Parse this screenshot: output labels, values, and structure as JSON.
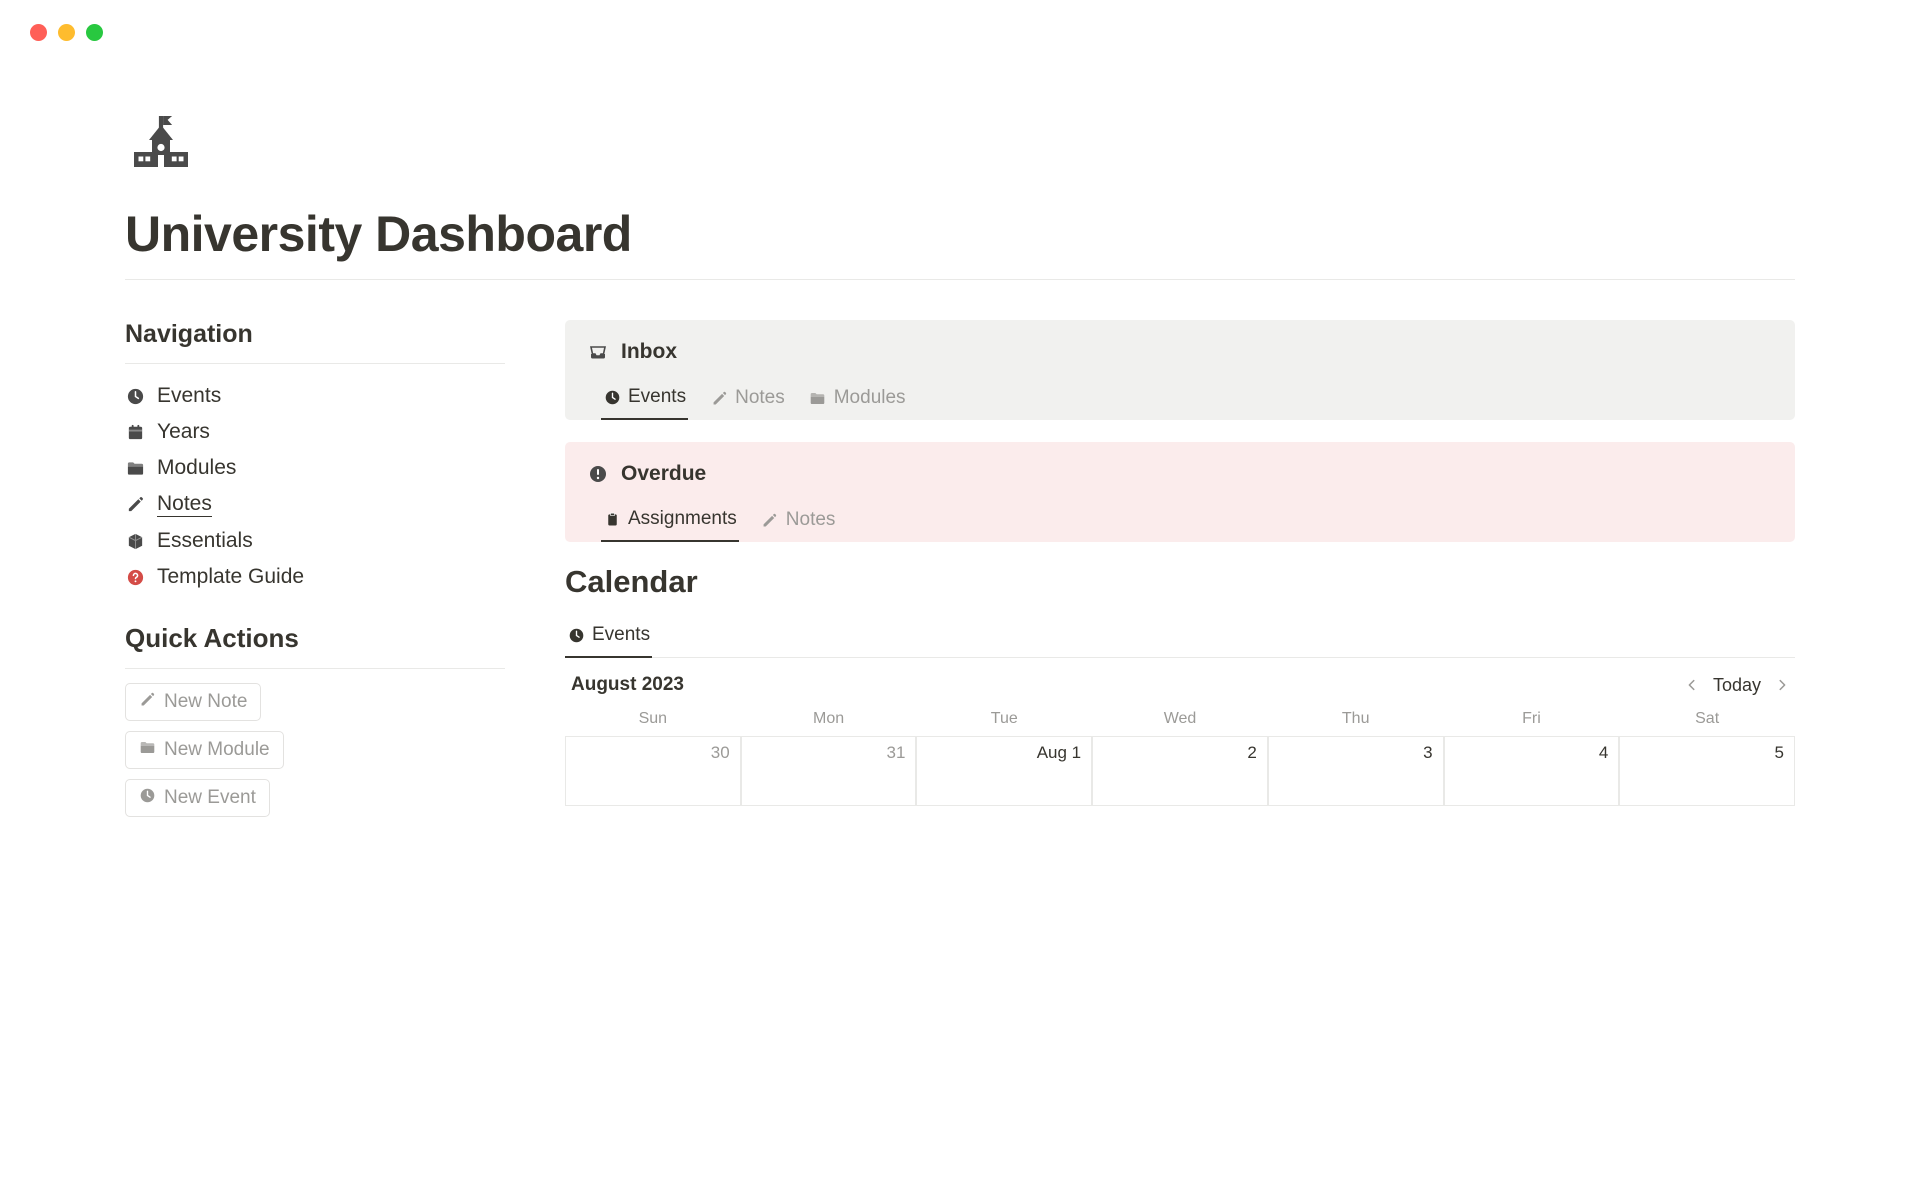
{
  "traffic": {
    "colors": [
      "#ff5f57",
      "#febc2e",
      "#28c840"
    ]
  },
  "page": {
    "title": "University Dashboard"
  },
  "navigation": {
    "heading": "Navigation",
    "items": [
      {
        "icon": "clock",
        "label": "Events"
      },
      {
        "icon": "calendar",
        "label": "Years"
      },
      {
        "icon": "folder",
        "label": "Modules"
      },
      {
        "icon": "pencil",
        "label": "Notes",
        "underline": true
      },
      {
        "icon": "box",
        "label": "Essentials"
      },
      {
        "icon": "help-red",
        "label": "Template Guide"
      }
    ]
  },
  "quickActions": {
    "heading": "Quick Actions",
    "items": [
      {
        "icon": "pencil",
        "label": "New Note"
      },
      {
        "icon": "folder",
        "label": "New Module"
      },
      {
        "icon": "clock",
        "label": "New Event"
      }
    ]
  },
  "inbox": {
    "title": "Inbox",
    "tabs": [
      {
        "icon": "clock",
        "label": "Events",
        "active": true
      },
      {
        "icon": "pencil",
        "label": "Notes",
        "active": false
      },
      {
        "icon": "folder",
        "label": "Modules",
        "active": false
      }
    ]
  },
  "overdue": {
    "title": "Overdue",
    "tabs": [
      {
        "icon": "clipboard",
        "label": "Assignments",
        "active": true
      },
      {
        "icon": "pencil",
        "label": "Notes",
        "active": false
      }
    ]
  },
  "calendar": {
    "heading": "Calendar",
    "tab": {
      "icon": "clock",
      "label": "Events"
    },
    "month": "August 2023",
    "today_label": "Today",
    "dow": [
      "Sun",
      "Mon",
      "Tue",
      "Wed",
      "Thu",
      "Fri",
      "Sat"
    ],
    "row": [
      {
        "label": "30",
        "other": true
      },
      {
        "label": "31",
        "other": true
      },
      {
        "label": "Aug 1",
        "other": false
      },
      {
        "label": "2",
        "other": false
      },
      {
        "label": "3",
        "other": false
      },
      {
        "label": "4",
        "other": false
      },
      {
        "label": "5",
        "other": false
      }
    ]
  }
}
